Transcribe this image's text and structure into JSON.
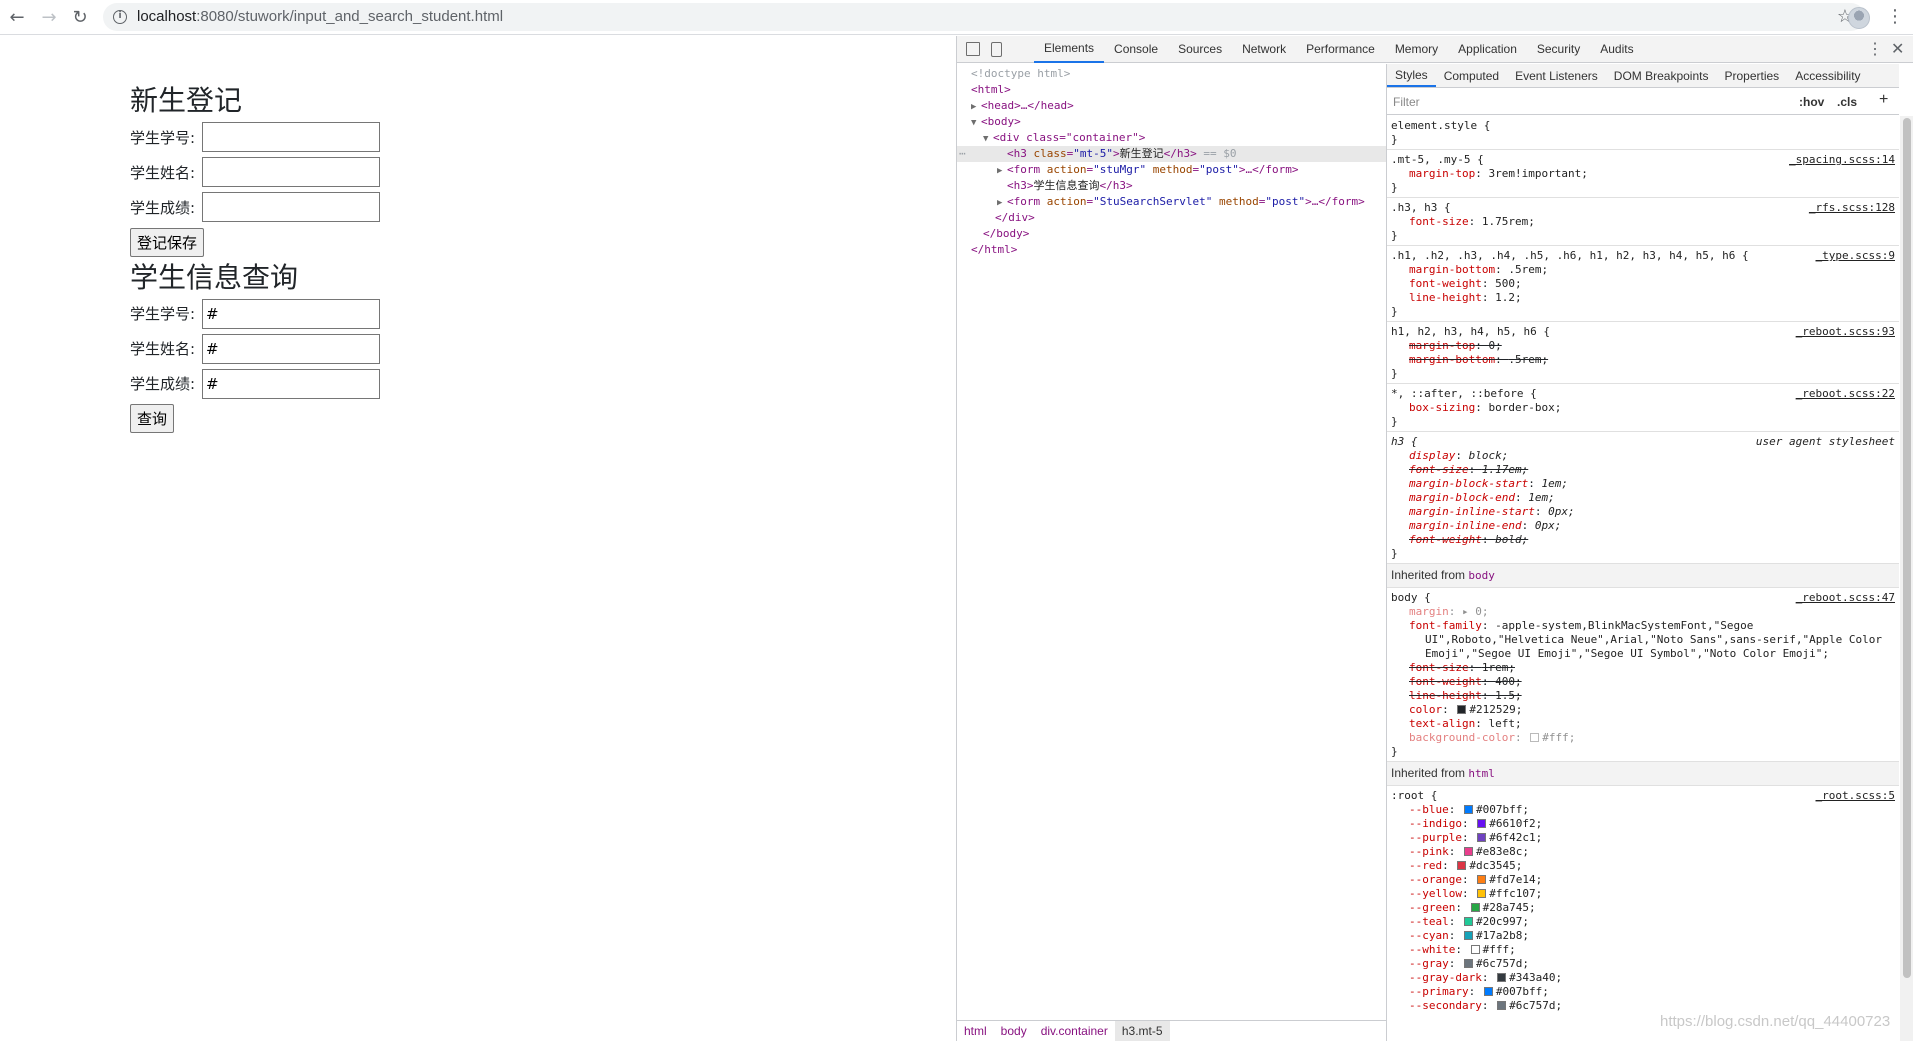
{
  "browser": {
    "url_host": "localhost",
    "url_path": ":8080/stuwork/input_and_search_student.html"
  },
  "page": {
    "register_title": "新生登记",
    "register_fields": [
      {
        "label": "学生学号:",
        "value": ""
      },
      {
        "label": "学生姓名:",
        "value": ""
      },
      {
        "label": "学生成绩:",
        "value": ""
      }
    ],
    "register_button": "登记保存",
    "search_title": "学生信息查询",
    "search_fields": [
      {
        "label": "学生学号:",
        "value": "#"
      },
      {
        "label": "学生姓名:",
        "value": "#"
      },
      {
        "label": "学生成绩:",
        "value": "#"
      }
    ],
    "search_button": "查询"
  },
  "devtools": {
    "tabs": [
      "Elements",
      "Console",
      "Sources",
      "Network",
      "Performance",
      "Memory",
      "Application",
      "Security",
      "Audits"
    ],
    "active_tab": "Elements",
    "dom": {
      "doctype": "<!doctype html>",
      "html_open": "<html>",
      "head": "<head>…</head>",
      "body_open": "<body>",
      "div_open": "<div class=\"container\">",
      "h3_text": "新生登记",
      "h3_marker": "== $0",
      "form1_action": "stuMgr",
      "form_method": "post",
      "h3b_text": "学生信息查询",
      "form2_action": "StuSearchServlet",
      "div_close": "</div>",
      "body_close": "</body>",
      "html_close": "</html>"
    },
    "breadcrumbs": [
      "html",
      "body",
      "div.container",
      "h3.mt-5"
    ],
    "side_tabs": [
      "Styles",
      "Computed",
      "Event Listeners",
      "DOM Breakpoints",
      "Properties",
      "Accessibility"
    ],
    "filter_placeholder": "Filter",
    "hov": ":hov",
    "cls": ".cls",
    "inherited_body_label": "Inherited from",
    "inherited_body_tag": "body",
    "inherited_html_tag": "html",
    "rules": {
      "element_style": "element.style {",
      "r1_sel": ".mt-5, .my-5 {",
      "r1_src": "_spacing.scss:14",
      "r1_d1p": "margin-top",
      "r1_d1v": "3rem!important;",
      "r2_sel": ".h3, h3 {",
      "r2_src": "_rfs.scss:128",
      "r2_d1p": "font-size",
      "r2_d1v": "1.75rem;",
      "r3_sel": ".h1, .h2, .h3, .h4, .h5, .h6, h1, h2, h3, h4, h5, h6 {",
      "r3_src": "_type.scss:9",
      "r3_d1p": "margin-bottom",
      "r3_d1v": ".5rem;",
      "r3_d2p": "font-weight",
      "r3_d2v": "500;",
      "r3_d3p": "line-height",
      "r3_d3v": "1.2;",
      "r4_sel": "h1, h2, h3, h4, h5, h6 {",
      "r4_src": "_reboot.scss:93",
      "r4_d1p": "margin-top",
      "r4_d1v": "0;",
      "r4_d2p": "margin-bottom",
      "r4_d2v": ".5rem;",
      "r5_sel": "*, ::after, ::before {",
      "r5_src": "_reboot.scss:22",
      "r5_d1p": "box-sizing",
      "r5_d1v": "border-box;",
      "r6_sel": "h3 {",
      "r6_src": "user agent stylesheet",
      "r6_decls": [
        [
          "display",
          "block;",
          false
        ],
        [
          "font-size",
          "1.17em;",
          true
        ],
        [
          "margin-block-start",
          "1em;",
          false
        ],
        [
          "margin-block-end",
          "1em;",
          false
        ],
        [
          "margin-inline-start",
          "0px;",
          false
        ],
        [
          "margin-inline-end",
          "0px;",
          false
        ],
        [
          "font-weight",
          "bold;",
          true
        ]
      ],
      "r7_sel": "body {",
      "r7_src": "_reboot.scss:47",
      "r7_margin_p": "margin",
      "r7_margin_v": "▸ 0;",
      "r7_ff_p": "font-family",
      "r7_ff_v": "-apple-system,BlinkMacSystemFont,\"Segoe",
      "r7_ff_v2": "UI\",Roboto,\"Helvetica Neue\",Arial,\"Noto Sans\",sans-serif,\"Apple Color",
      "r7_ff_v3": "Emoji\",\"Segoe UI Emoji\",\"Segoe UI Symbol\",\"Noto Color Emoji\";",
      "r7_fs_p": "font-size",
      "r7_fs_v": "1rem;",
      "r7_fw_p": "font-weight",
      "r7_fw_v": "400;",
      "r7_lh_p": "line-height",
      "r7_lh_v": "1.5;",
      "r7_color_p": "color",
      "r7_color_v": "#212529;",
      "r7_ta_p": "text-align",
      "r7_ta_v": "left;",
      "r7_bg_p": "background-color",
      "r7_bg_v": "#fff;",
      "root_sel": ":root {",
      "root_src": "_root.scss:5"
    },
    "root_vars": [
      {
        "name": "--blue",
        "value": "#007bff;",
        "color": "#007bff"
      },
      {
        "name": "--indigo",
        "value": "#6610f2;",
        "color": "#6610f2"
      },
      {
        "name": "--purple",
        "value": "#6f42c1;",
        "color": "#6f42c1"
      },
      {
        "name": "--pink",
        "value": "#e83e8c;",
        "color": "#e83e8c"
      },
      {
        "name": "--red",
        "value": "#dc3545;",
        "color": "#dc3545"
      },
      {
        "name": "--orange",
        "value": "#fd7e14;",
        "color": "#fd7e14"
      },
      {
        "name": "--yellow",
        "value": "#ffc107;",
        "color": "#ffc107"
      },
      {
        "name": "--green",
        "value": "#28a745;",
        "color": "#28a745"
      },
      {
        "name": "--teal",
        "value": "#20c997;",
        "color": "#20c997"
      },
      {
        "name": "--cyan",
        "value": "#17a2b8;",
        "color": "#17a2b8"
      },
      {
        "name": "--white",
        "value": "#fff;",
        "color": "#ffffff"
      },
      {
        "name": "--gray",
        "value": "#6c757d;",
        "color": "#6c757d"
      },
      {
        "name": "--gray-dark",
        "value": "#343a40;",
        "color": "#343a40"
      },
      {
        "name": "--primary",
        "value": "#007bff;",
        "color": "#007bff"
      },
      {
        "name": "--secondary",
        "value": "#6c757d;",
        "color": "#6c757d"
      }
    ]
  },
  "watermark": "https://blog.csdn.net/qq_44400723"
}
